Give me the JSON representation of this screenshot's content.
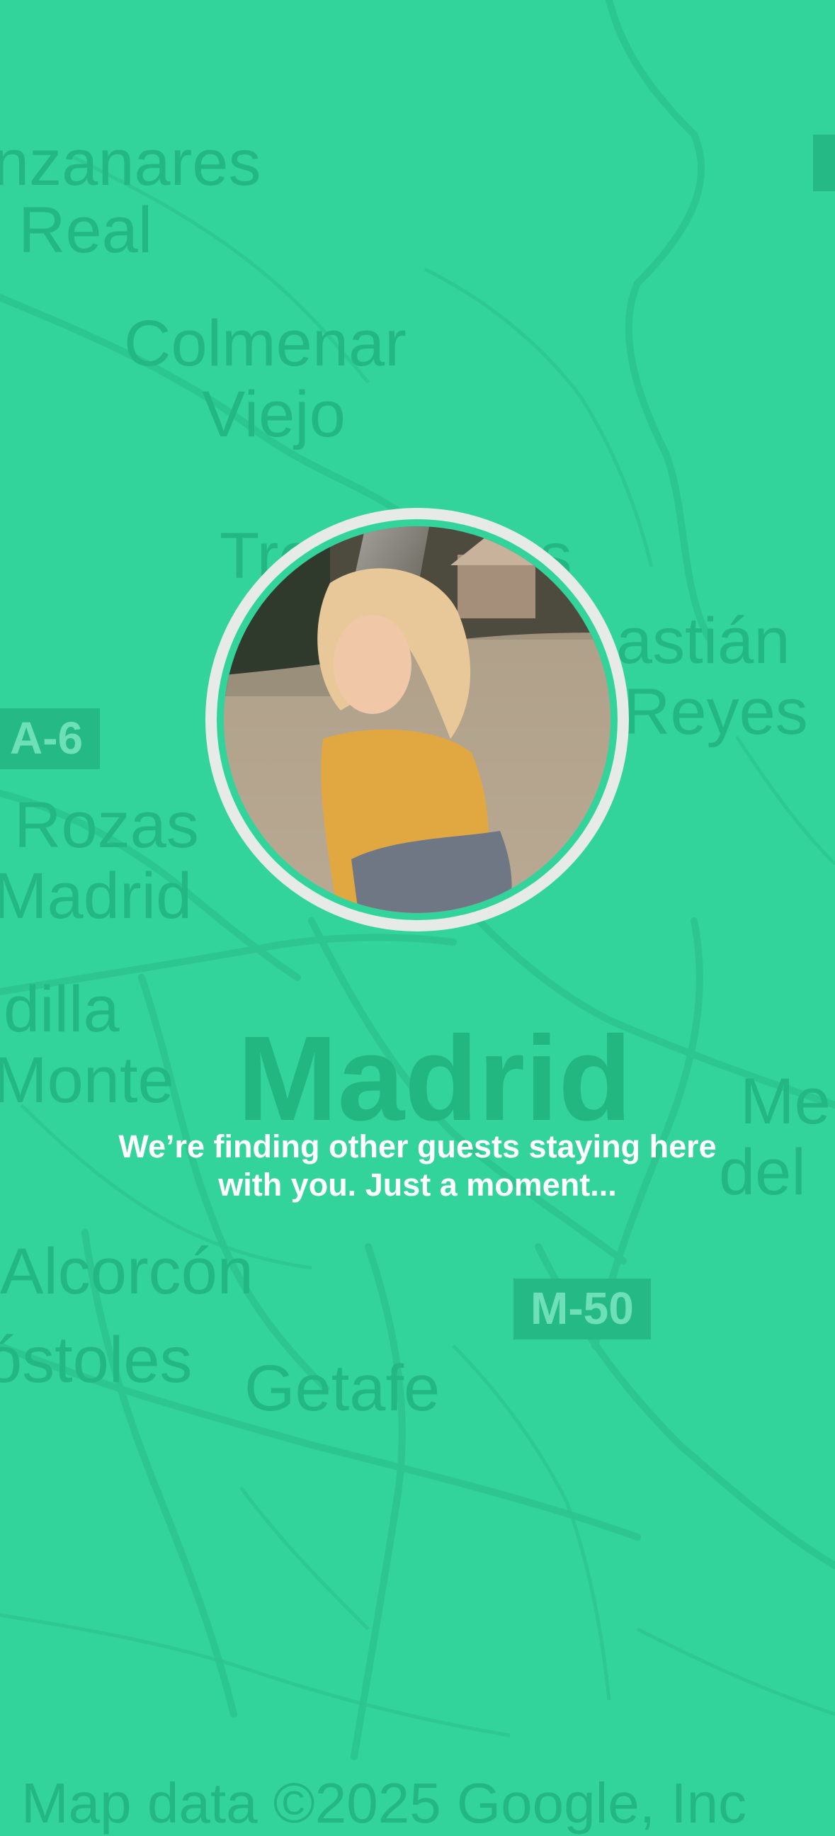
{
  "background": {
    "color": "#33d39c",
    "map_labels": {
      "manzanares": "nzanares",
      "real": "l Real",
      "colmenar": "Colmenar",
      "viejo": "Viejo",
      "tres_cantos": "Tres Cantos",
      "sebastian": "astián",
      "reyes": "Reyes",
      "rozas": "Rozas",
      "madrid_small": "Madrid",
      "boadilla": "dilla",
      "monte": "Monte",
      "madrid": "Madrid",
      "mejorada": "Me",
      "del": "del",
      "alcorcon": "Alcorcón",
      "mostoles": "óstoles",
      "getafe": "Getafe"
    },
    "road_shields": {
      "a6": "A-6",
      "m50": "M-50"
    },
    "attribution": "Map data ©2025 Google, Inc"
  },
  "avatar": {
    "description": "profile-photo-icon",
    "ring_color": "#e6ebe8"
  },
  "message": {
    "line1": "We’re finding other guests staying here",
    "line2": "with you. Just a moment..."
  }
}
